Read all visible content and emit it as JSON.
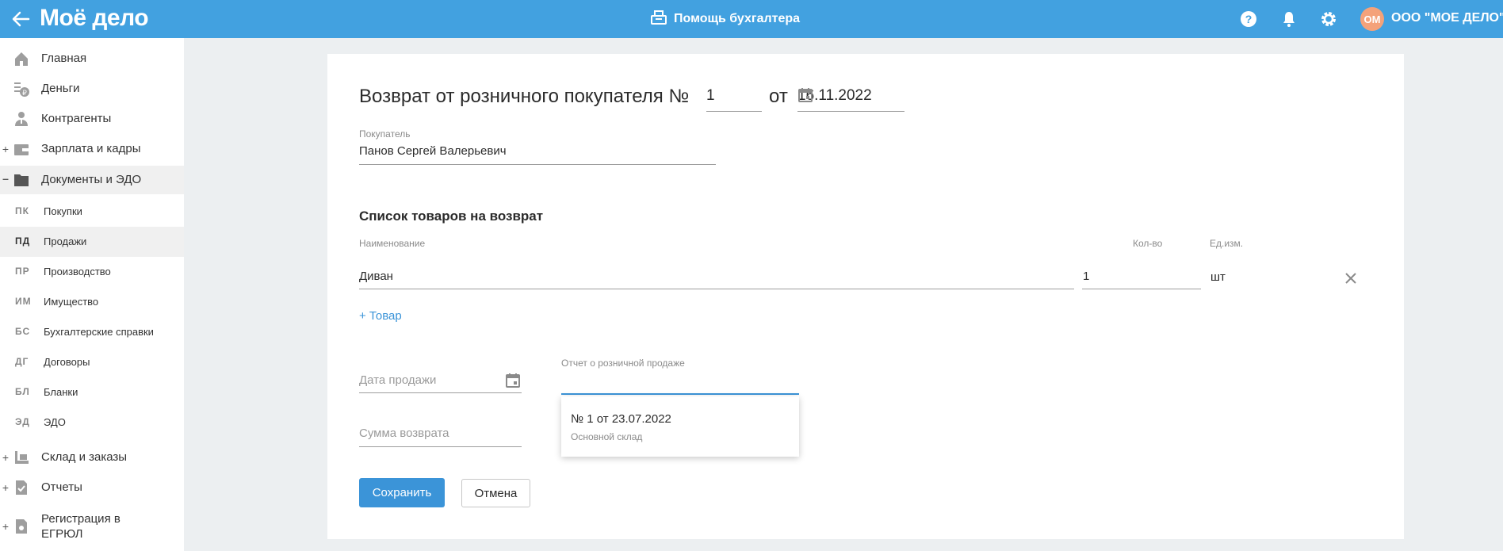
{
  "topbar": {
    "logo": "Моё дело",
    "helper_label": "Помощь бухгалтера",
    "avatar_initials": "ОМ",
    "company": "ООО \"МОЕ ДЕЛО\"",
    "brand_color": "#42a1e0",
    "avatar_color": "#f4a27a"
  },
  "sidebar": {
    "items": [
      {
        "label": "Главная",
        "icon": "home-icon",
        "expand": ""
      },
      {
        "label": "Деньги",
        "icon": "money-icon",
        "expand": ""
      },
      {
        "label": "Контрагенты",
        "icon": "contractors-icon",
        "expand": ""
      },
      {
        "label": "Зарплата и кадры",
        "icon": "wallet-icon",
        "expand": "+"
      },
      {
        "label": "Документы и ЭДО",
        "icon": "folder-icon",
        "expand": "–"
      },
      {
        "label": "Склад и заказы",
        "icon": "warehouse-icon",
        "expand": "+"
      },
      {
        "label": "Отчеты",
        "icon": "report-icon",
        "expand": "+"
      },
      {
        "label": "Регистрация в ЕГРЮЛ",
        "icon": "registration-icon",
        "expand": "+"
      }
    ],
    "subitems": [
      {
        "abbr": "ПК",
        "label": "Покупки"
      },
      {
        "abbr": "ПД",
        "label": "Продажи"
      },
      {
        "abbr": "ПР",
        "label": "Производство"
      },
      {
        "abbr": "ИМ",
        "label": "Имущество"
      },
      {
        "abbr": "БС",
        "label": "Бухгалтерские справки"
      },
      {
        "abbr": "ДГ",
        "label": "Договоры"
      },
      {
        "abbr": "БЛ",
        "label": "Бланки"
      },
      {
        "abbr": "ЭД",
        "label": "ЭДО"
      }
    ]
  },
  "form": {
    "title": "Возврат от розничного покупателя №",
    "number": "1",
    "date_prefix": "от",
    "date": "16.11.2022",
    "buyer_label": "Покупатель",
    "buyer_value": "Панов Сергей Валерьевич",
    "section_title": "Список товаров на возврат",
    "columns": {
      "name": "Наименование",
      "qty": "Кол-во",
      "unit": "Ед.изм."
    },
    "items": [
      {
        "name": "Диван",
        "qty": "1",
        "unit": "шт"
      }
    ],
    "add_item": "+ Товар",
    "sale_date_placeholder": "Дата продажи",
    "report_label": "Отчет о розничной продаже",
    "return_sum_placeholder": "Сумма возврата",
    "dropdown": {
      "title": "№ 1 от 23.07.2022",
      "subtitle": "Основной склад"
    },
    "save": "Сохранить",
    "cancel": "Отмена"
  }
}
